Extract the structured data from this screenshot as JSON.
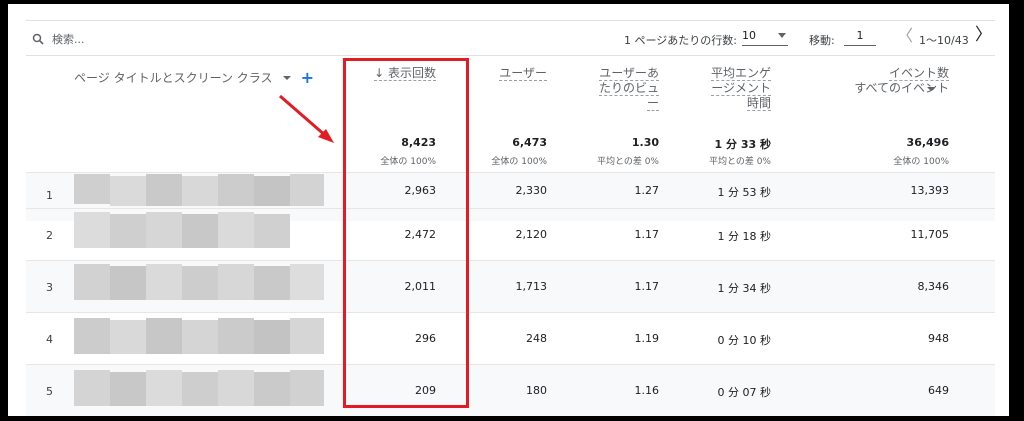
{
  "toolbar": {
    "search_placeholder": "検索...",
    "rows_per_page_label": "1 ページあたりの行数:",
    "rows_per_page_value": "10",
    "goto_label": "移動:",
    "goto_value": "1",
    "prev_symbol": "〈",
    "range_text": "1〜10/43",
    "next_symbol": "〉"
  },
  "table": {
    "dimension_header": "ページ タイトルとスクリーン クラス",
    "add_symbol": "+",
    "columns": [
      {
        "label": "↓ 表示回数",
        "total": "8,423",
        "sub": "全体の 100%"
      },
      {
        "label": "ユーザー",
        "total": "6,473",
        "sub": "全体の 100%"
      },
      {
        "label_lines": [
          "ユーザーあ",
          "たりのビュ",
          "ー"
        ],
        "total": "1.30",
        "sub": "平均との差 0%"
      },
      {
        "label_lines": [
          "平均エンゲ",
          "ージメント",
          "時間"
        ],
        "total": "1 分 33 秒",
        "sub": "平均との差 0%"
      },
      {
        "label_lines": [
          "イベント数",
          "すべてのイベント"
        ],
        "total": "36,496",
        "sub": "全体の 100%"
      }
    ],
    "rows": [
      {
        "index": "1",
        "cells": [
          "2,963",
          "2,330",
          "1.27",
          "1 分 53 秒",
          "13,393"
        ]
      },
      {
        "index": "2",
        "cells": [
          "2,472",
          "2,120",
          "1.17",
          "1 分 18 秒",
          "11,705"
        ]
      },
      {
        "index": "3",
        "cells": [
          "2,011",
          "1,713",
          "1.17",
          "1 分 34 秒",
          "8,346"
        ]
      },
      {
        "index": "4",
        "cells": [
          "296",
          "248",
          "1.19",
          "0 分 10 秒",
          "948"
        ]
      },
      {
        "index": "5",
        "cells": [
          "209",
          "180",
          "1.16",
          "0 分 07 秒",
          "649"
        ]
      }
    ]
  },
  "colors": {
    "highlight": "#e31b23",
    "accent": "#1a73e8"
  }
}
